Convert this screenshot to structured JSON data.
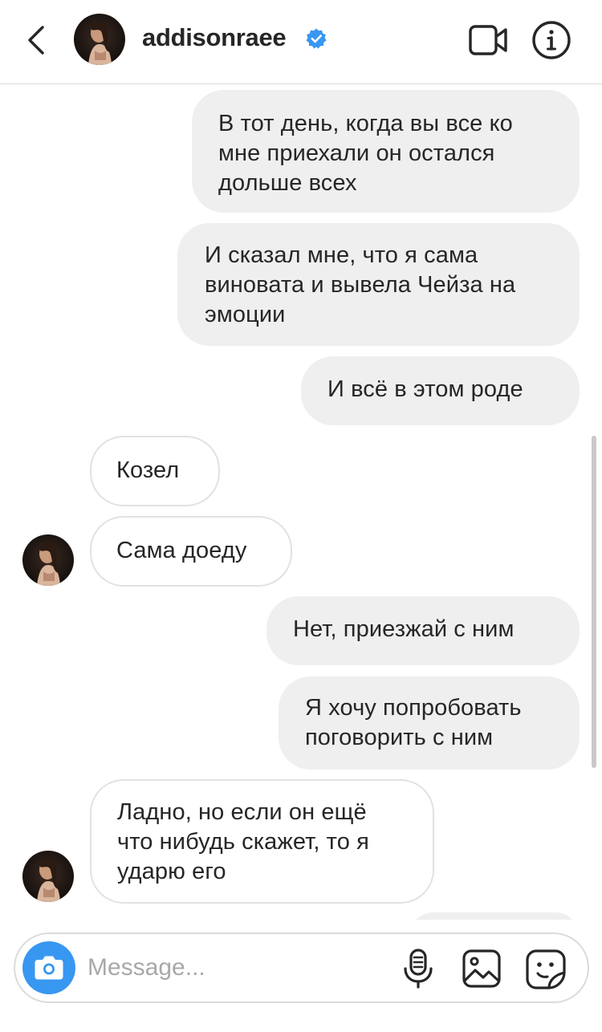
{
  "header": {
    "username": "addisonraee",
    "verified": true,
    "back_icon": "chevron-left-icon",
    "video_icon": "video-camera-icon",
    "info_icon": "info-icon",
    "accent_color": "#3897f0"
  },
  "messages": [
    {
      "sender": "me",
      "text": "В тот день, когда вы все ко\nмне приехали он остался\nдольше всех"
    },
    {
      "sender": "me",
      "text": "И сказал мне, что я сама\nвиновата и вывела Чейза на\nэмоции"
    },
    {
      "sender": "me",
      "text": "И всё в этом роде"
    },
    {
      "sender": "them",
      "text": "Козел"
    },
    {
      "sender": "them",
      "text": "Сама доеду"
    },
    {
      "sender": "me",
      "text": "Нет, приезжай с ним"
    },
    {
      "sender": "me",
      "text": "Я хочу попробовать\nпоговорить с ним"
    },
    {
      "sender": "them",
      "text": "Ладно, но если он ещё\nчто нибудь скажет, то я\nударю его"
    }
  ],
  "composer": {
    "placeholder": "Message...",
    "camera_icon": "camera-icon",
    "mic_icon": "microphone-icon",
    "gallery_icon": "gallery-icon",
    "sticker_icon": "sticker-icon"
  }
}
